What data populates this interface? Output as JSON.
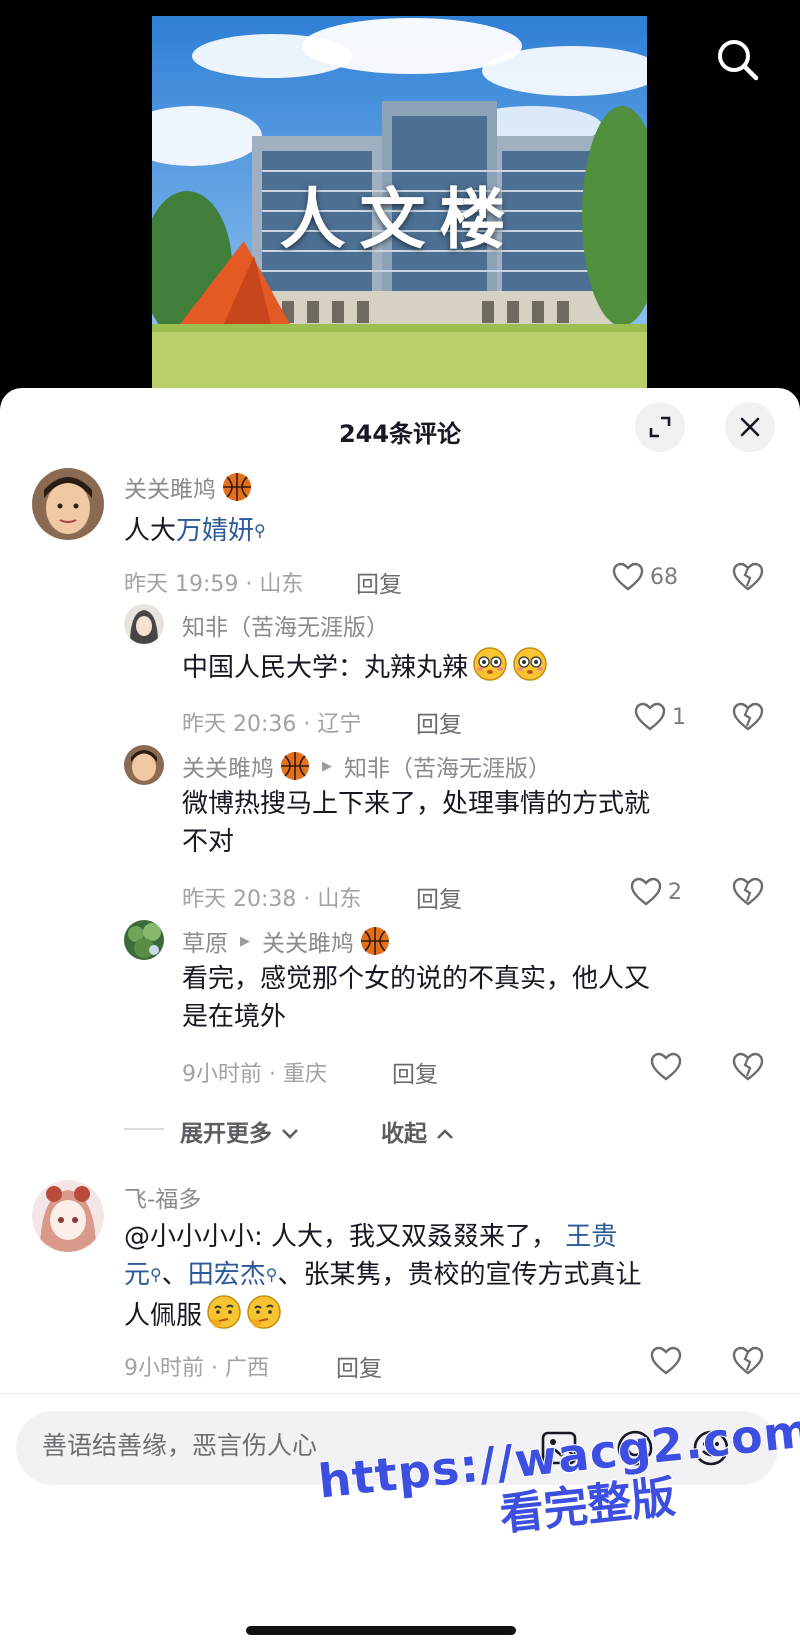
{
  "video": {
    "thumbnail_text": "人文楼"
  },
  "sheet": {
    "title": "244条评论"
  },
  "comments": [
    {
      "user": "关关雎鸠",
      "text_prefix": "人大",
      "mention": "万婧妍",
      "time_loc": "昨天 19:59 · 山东",
      "reply_label": "回复",
      "likes": "68"
    },
    {
      "user": "知非（苦海无涯版）",
      "text": "中国人民大学：丸辣丸辣",
      "time_loc": "昨天 20:36 · 辽宁",
      "reply_label": "回复",
      "likes": "1"
    },
    {
      "user": "关关雎鸠",
      "reply_to": "知非（苦海无涯版）",
      "text_line1": "微博热搜马上下来了，处理事情的方式就",
      "text_line2": "不对",
      "time_loc": "昨天 20:38 · 山东",
      "reply_label": "回复",
      "likes": "2"
    },
    {
      "user": "草原",
      "reply_to": "关关雎鸠",
      "text_line1": "看完，感觉那个女的说的不真实，他人又",
      "text_line2": "是在境外",
      "time_loc": "9小时前 · 重庆",
      "reply_label": "回复"
    },
    {
      "user": "飞-福多",
      "text_a": "@小小小小: 人大，我又双叒叕来了，",
      "mention1": "王贵元",
      "mention2": "田宏杰",
      "text_b": "、张某隽，贵校的宣传方式真让",
      "text_c": "人佩服",
      "time_loc": "9小时前 · 广西",
      "reply_label": "回复"
    }
  ],
  "replies_footer": {
    "expand_label": "展开更多",
    "collapse_label": "收起"
  },
  "input": {
    "placeholder": "善语结善缘，恶言伤人心"
  },
  "watermark": {
    "url": "https://wacg2.com",
    "subtitle": "看完整版"
  },
  "colors": {
    "link": "#2b5a9a",
    "watermark": "#3d4fe0"
  }
}
